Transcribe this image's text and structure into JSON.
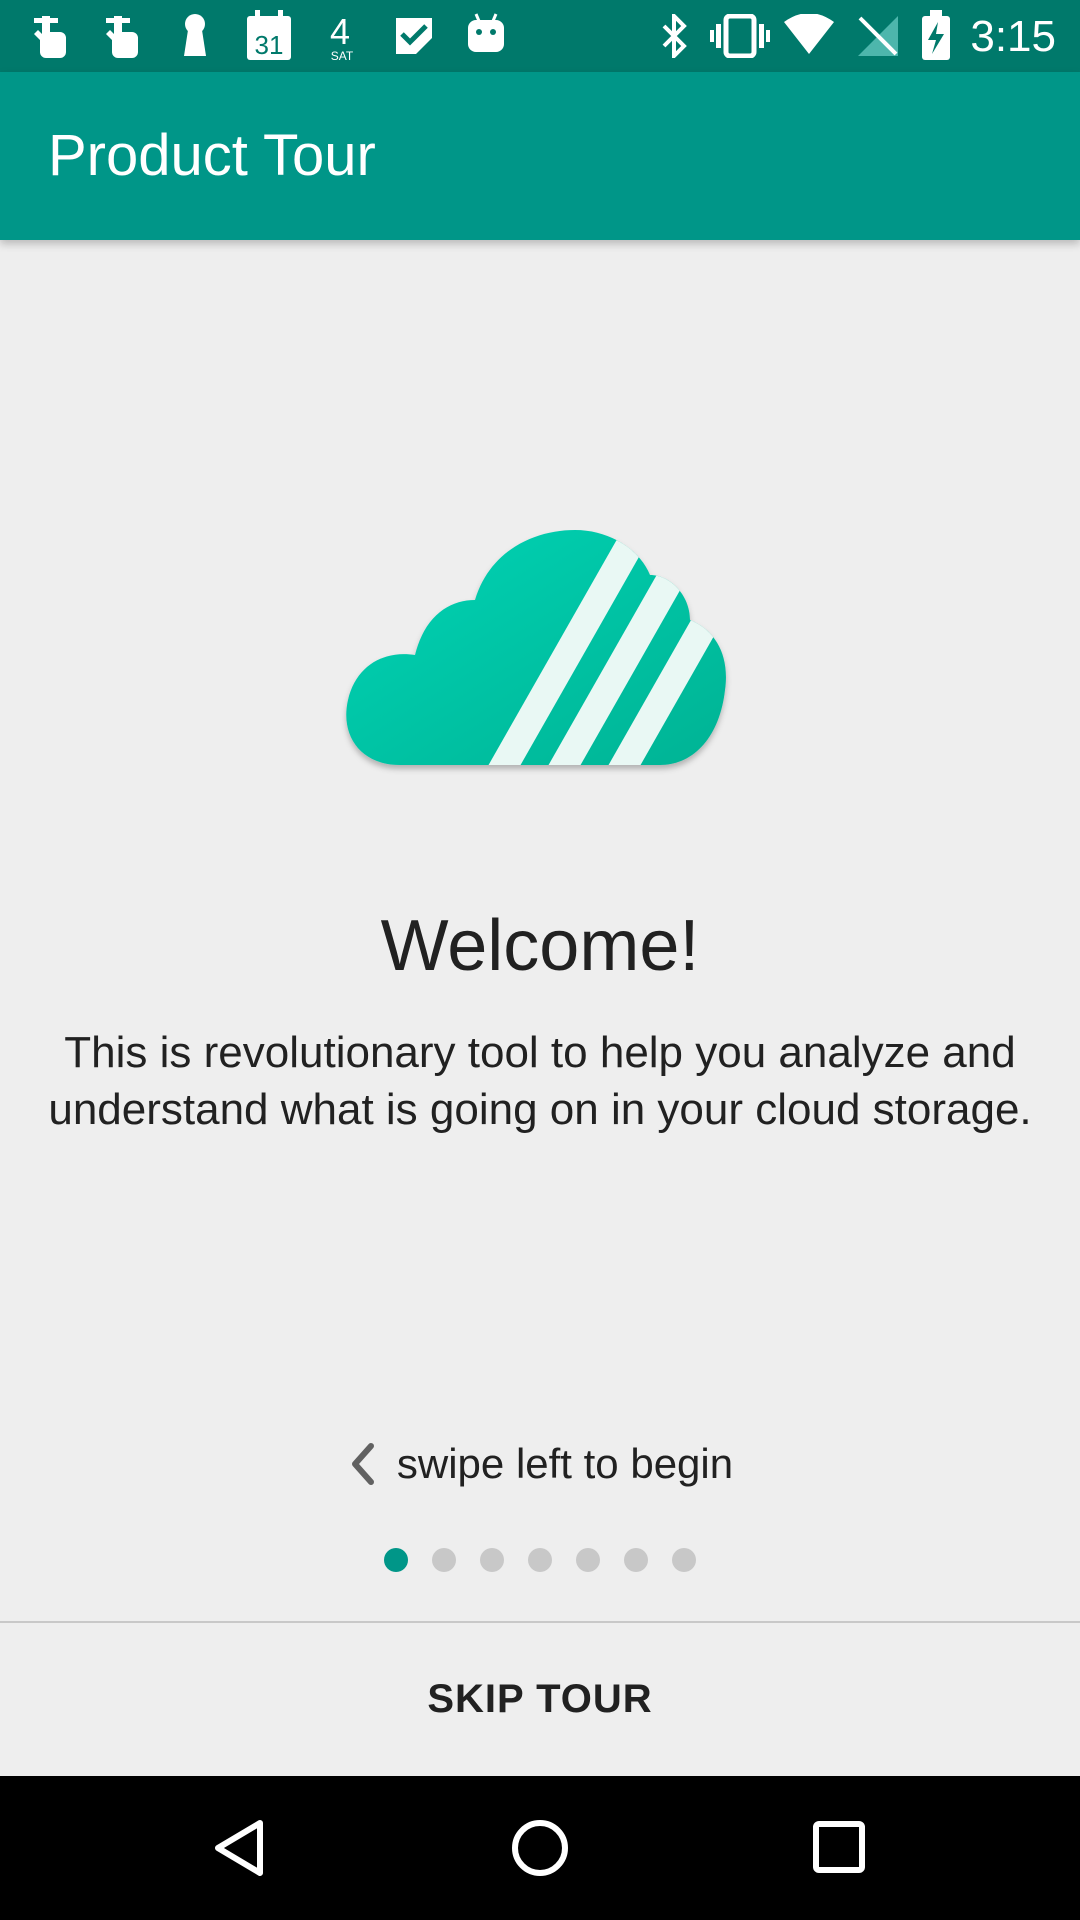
{
  "status_bar": {
    "time": "3:15",
    "left_icons": [
      "hand-point-icon",
      "hand-point-icon",
      "keyhole-icon",
      "calendar-icon",
      "weather-date-icon",
      "check-icon",
      "android-icon"
    ],
    "calendar_day": "31",
    "weather_day": "4",
    "weather_label": "SAT",
    "right_icons": [
      "bluetooth-icon",
      "vibrate-icon",
      "wifi-icon",
      "no-signal-icon",
      "battery-charging-icon"
    ]
  },
  "app_bar": {
    "title": "Product Tour"
  },
  "page": {
    "welcome_title": "Welcome!",
    "description": "This is revolutionary tool to help you analyze and understand what is going on in your cloud storage.",
    "swipe_hint": "swipe left to begin",
    "total_pages": 7,
    "current_page": 1
  },
  "footer": {
    "skip_label": "SKIP TOUR"
  },
  "colors": {
    "status_bar": "#00796b",
    "app_bar": "#009688",
    "accent": "#009688",
    "background": "#eeeeee",
    "cloud": "#00c4a7"
  }
}
